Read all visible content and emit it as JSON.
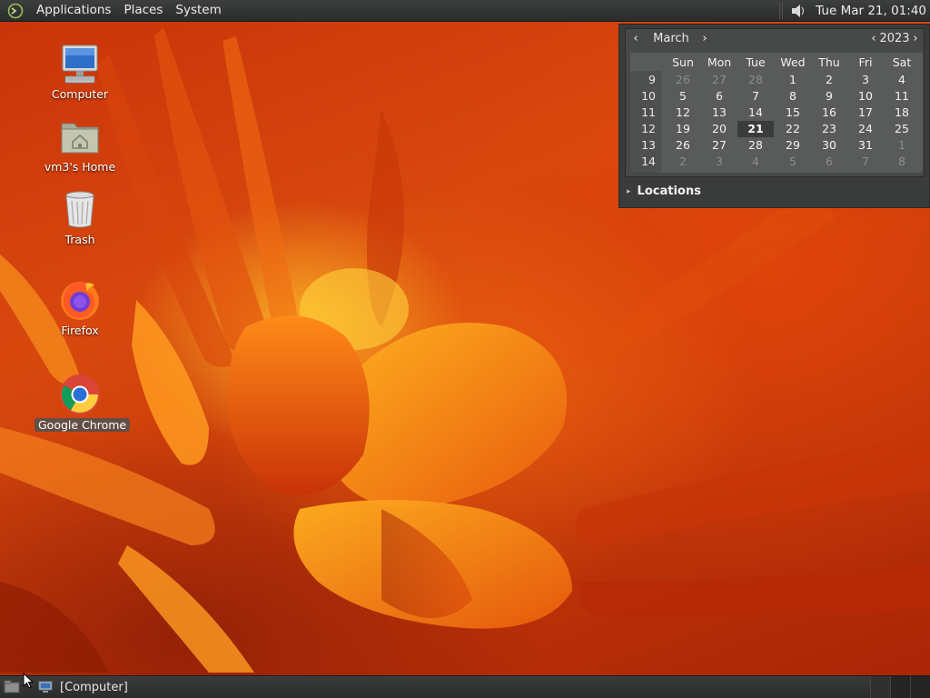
{
  "top_panel": {
    "menus": [
      "Applications",
      "Places",
      "System"
    ],
    "clock": "Tue Mar 21, 01:40"
  },
  "calendar": {
    "month": "March",
    "year": "2023",
    "weekdays": [
      "Sun",
      "Mon",
      "Tue",
      "Wed",
      "Thu",
      "Fri",
      "Sat"
    ],
    "weeks": [
      {
        "num": "9",
        "days": [
          "26",
          "27",
          "28",
          "1",
          "2",
          "3",
          "4"
        ]
      },
      {
        "num": "10",
        "days": [
          "5",
          "6",
          "7",
          "8",
          "9",
          "10",
          "11"
        ]
      },
      {
        "num": "11",
        "days": [
          "12",
          "13",
          "14",
          "15",
          "16",
          "17",
          "18"
        ]
      },
      {
        "num": "12",
        "days": [
          "19",
          "20",
          "21",
          "22",
          "23",
          "24",
          "25"
        ]
      },
      {
        "num": "13",
        "days": [
          "26",
          "27",
          "28",
          "29",
          "30",
          "31",
          "1"
        ]
      },
      {
        "num": "14",
        "days": [
          "2",
          "3",
          "4",
          "5",
          "6",
          "7",
          "8"
        ]
      }
    ],
    "other_month": [
      [
        true,
        true,
        true,
        false,
        false,
        false,
        false
      ],
      [
        false,
        false,
        false,
        false,
        false,
        false,
        false
      ],
      [
        false,
        false,
        false,
        false,
        false,
        false,
        false
      ],
      [
        false,
        false,
        false,
        false,
        false,
        false,
        false
      ],
      [
        false,
        false,
        false,
        false,
        false,
        false,
        true
      ],
      [
        true,
        true,
        true,
        true,
        true,
        true,
        true
      ]
    ],
    "today": "21",
    "locations_label": "Locations"
  },
  "desktop_icons": {
    "computer": "Computer",
    "home": "vm3's Home",
    "trash": "Trash",
    "firefox": "Firefox",
    "chrome": "Google Chrome"
  },
  "taskbar": {
    "task_label": "[Computer]"
  },
  "colors": {
    "panel": "#2b2d2c",
    "calendar_bg": "#3a3c3b",
    "wallpaper_accent": "#d8480e"
  }
}
